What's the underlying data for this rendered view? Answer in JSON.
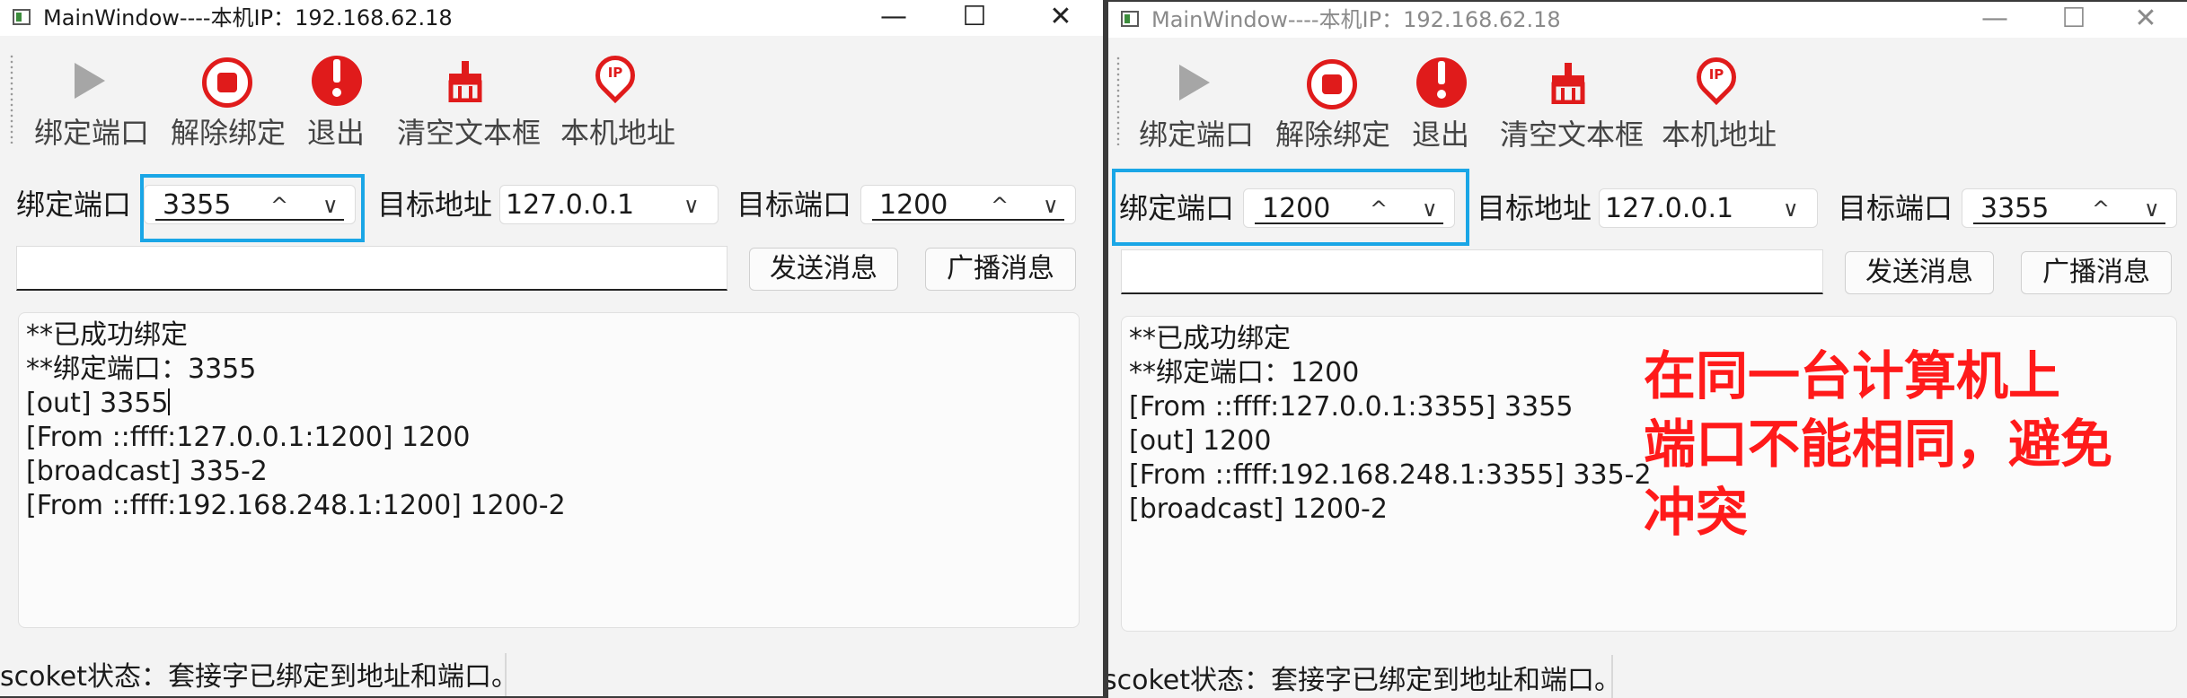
{
  "left_window": {
    "title": "MainWindow----本机IP：192.168.62.18",
    "controls": {
      "minimize": "—",
      "maximize": "☐",
      "close": "✕"
    },
    "toolbar": [
      "绑定端口",
      "解除绑定",
      "退出",
      "清空文本框",
      "本机地址"
    ],
    "bind_port_label": "绑定端口",
    "bind_port_value": "3355",
    "target_addr_label": "目标地址",
    "target_addr_value": "127.0.0.1",
    "target_port_label": "目标端口",
    "target_port_value": "1200",
    "send_button": "发送消息",
    "broadcast_button": "广播消息",
    "log_lines": [
      "**已成功绑定",
      "**绑定端口：3355",
      "[out] 3355",
      "[From ::ffff:127.0.0.1:1200] 1200",
      "[broadcast] 335-2",
      "[From ::ffff:192.168.248.1:1200] 1200-2"
    ],
    "status": "scoket状态：套接字已绑定到地址和端口。"
  },
  "right_window": {
    "title": "MainWindow----本机IP：192.168.62.18",
    "controls": {
      "minimize": "—",
      "maximize": "☐",
      "close": "✕"
    },
    "toolbar": [
      "绑定端口",
      "解除绑定",
      "退出",
      "清空文本框",
      "本机地址"
    ],
    "bind_port_label": "绑定端口",
    "bind_port_value": "1200",
    "target_addr_label": "目标地址",
    "target_addr_value": "127.0.0.1",
    "target_port_label": "目标端口",
    "target_port_value": "3355",
    "send_button": "发送消息",
    "broadcast_button": "广播消息",
    "log_lines": [
      "**已成功绑定",
      "**绑定端口：1200",
      "[From ::ffff:127.0.0.1:3355] 3355",
      "[out] 1200",
      "[From ::ffff:192.168.248.1:3355] 335-2",
      "[broadcast] 1200-2"
    ],
    "status": "scoket状态：套接字已绑定到地址和端口。"
  },
  "annotation": [
    "在同一台计算机上",
    "端口不能相同，避免",
    "冲突"
  ],
  "icons": {
    "chevron_up": "^",
    "chevron_down": "∨"
  },
  "colors": {
    "accent_red": "#e01b1b",
    "focus_blue": "#1aa6e6",
    "annotation_red": "#ff1a1a"
  }
}
